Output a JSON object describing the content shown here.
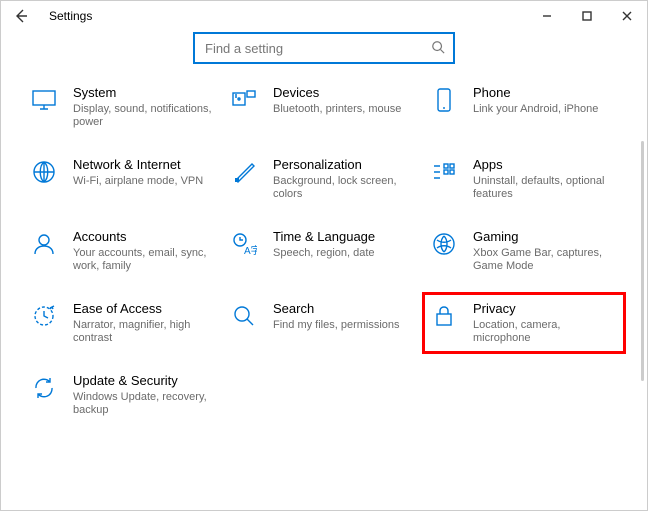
{
  "window": {
    "title": "Settings"
  },
  "search": {
    "placeholder": "Find a setting"
  },
  "tiles": {
    "system": {
      "label": "System",
      "sub": "Display, sound, notifications, power"
    },
    "devices": {
      "label": "Devices",
      "sub": "Bluetooth, printers, mouse"
    },
    "phone": {
      "label": "Phone",
      "sub": "Link your Android, iPhone"
    },
    "network": {
      "label": "Network & Internet",
      "sub": "Wi-Fi, airplane mode, VPN"
    },
    "personalize": {
      "label": "Personalization",
      "sub": "Background, lock screen, colors"
    },
    "apps": {
      "label": "Apps",
      "sub": "Uninstall, defaults, optional features"
    },
    "accounts": {
      "label": "Accounts",
      "sub": "Your accounts, email, sync, work, family"
    },
    "time": {
      "label": "Time & Language",
      "sub": "Speech, region, date"
    },
    "gaming": {
      "label": "Gaming",
      "sub": "Xbox Game Bar, captures, Game Mode"
    },
    "ease": {
      "label": "Ease of Access",
      "sub": "Narrator, magnifier, high contrast"
    },
    "searchcat": {
      "label": "Search",
      "sub": "Find my files, permissions"
    },
    "privacy": {
      "label": "Privacy",
      "sub": "Location, camera, microphone"
    },
    "update": {
      "label": "Update & Security",
      "sub": "Windows Update, recovery, backup"
    }
  },
  "highlighted": "privacy"
}
